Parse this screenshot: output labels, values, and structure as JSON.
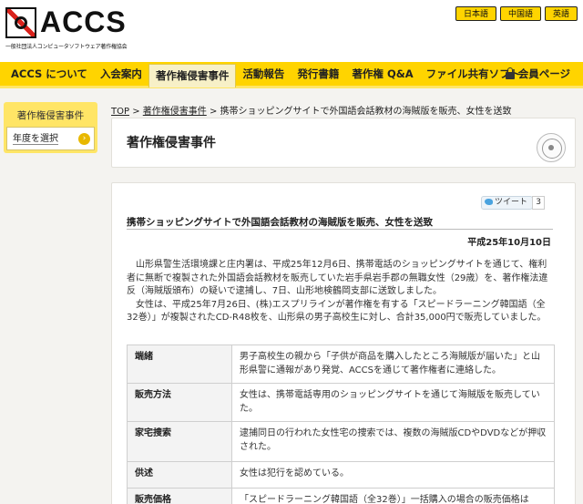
{
  "header": {
    "logo_text": "ACCS",
    "logo_subtitle": "一般社団法人コンピュータソフトウェア著作権協会",
    "languages": [
      {
        "label": "日本語",
        "active": true
      },
      {
        "label": "中国語",
        "active": false
      },
      {
        "label": "英語",
        "active": false
      }
    ]
  },
  "nav": {
    "items": [
      {
        "label": "ACCS について"
      },
      {
        "label": "入会案内"
      },
      {
        "label": "著作権侵害事件"
      },
      {
        "label": "活動報告"
      },
      {
        "label": "発行書籍"
      },
      {
        "label": "著作権 Q&A"
      },
      {
        "label": "ファイル共有ソフト"
      }
    ],
    "active_index": 2,
    "member_label": "会員ページ"
  },
  "sidebar": {
    "title": "著作権侵害事件",
    "link_label": "年度を選択",
    "arrow": "›"
  },
  "breadcrumb": {
    "top": "TOP",
    "sep": " > ",
    "section": "著作権侵害事件",
    "current": "携帯ショッピングサイトで外国語会話教材の海賊版を販売、女性を送致"
  },
  "page": {
    "title": "著作権侵害事件"
  },
  "article": {
    "tweet_label": "ツイート",
    "tweet_count": "3",
    "title": "携帯ショッピングサイトで外国語会話教材の海賊版を販売、女性を送致",
    "date": "平成25年10月10日",
    "paragraphs": [
      "山形県警生活環境課と庄内署は、平成25年12月6日、携帯電話のショッピングサイトを通じて、権利者に無断で複製された外国語会話教材を販売していた岩手県岩手郡の無職女性（29歳）を、著作権法違反（海賊版頒布）の疑いで逮捕し、7日、山形地検鶴岡支部に送致しました。",
      "女性は、平成25年7月26日、(株)エスプリラインが著作権を有する「スピードラーニング韓国語（全32巻）」が複製されたCD-R48枚を、山形県の男子高校生に対し、合計35,000円で販売していました。"
    ],
    "table": [
      {
        "label": "端緒",
        "value": "男子高校生の親から「子供が商品を購入したところ海賊版が届いた」と山形県警に通報があり発覚、ACCSを通じて著作権者に連絡した。"
      },
      {
        "label": "販売方法",
        "value": "女性は、携帯電話専用のショッピングサイトを通じて海賊版を販売していた。"
      },
      {
        "label": "家宅捜索",
        "value": "逮捕同日の行われた女性宅の捜索では、複数の海賊版CDやDVDなどが押収された。"
      },
      {
        "label": "供述",
        "value": "女性は犯行を認めている。"
      },
      {
        "label": "販売価格",
        "value": "「スピードラーニング韓国語（全32巻）」一括購入の場合の販売価格は"
      }
    ]
  }
}
